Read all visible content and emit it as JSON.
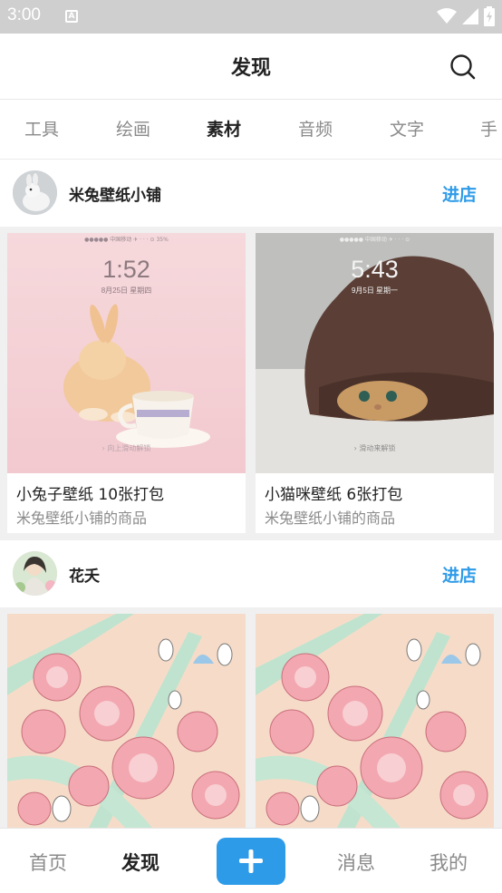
{
  "status_bar": {
    "time": "3:00"
  },
  "header": {
    "title": "发现"
  },
  "tabs": [
    {
      "label": "工具",
      "active": false
    },
    {
      "label": "绘画",
      "active": false
    },
    {
      "label": "素材",
      "active": true
    },
    {
      "label": "音频",
      "active": false
    },
    {
      "label": "文字",
      "active": false
    },
    {
      "label": "手",
      "active": false
    }
  ],
  "shops": [
    {
      "name": "米兔壁纸小铺",
      "enter_label": "进店",
      "products": [
        {
          "title": "小兔子壁纸 10张打包",
          "subtitle": "米兔壁纸小铺的商品",
          "lock_time": "1:52",
          "lock_date": "8月25日 星期四",
          "unlock_hint": "› 向上滑动解锁"
        },
        {
          "title": "小猫咪壁纸 6张打包",
          "subtitle": "米兔壁纸小铺的商品",
          "lock_time": "5:43",
          "lock_date": "9月5日 星期一",
          "unlock_hint": "› 滑动来解锁"
        }
      ]
    },
    {
      "name": "花夭",
      "enter_label": "进店",
      "products": []
    }
  ],
  "bottom_nav": {
    "home": "首页",
    "discover": "发现",
    "messages": "消息",
    "mine": "我的"
  },
  "colors": {
    "accent": "#2e9be8",
    "gap": "#f0f0f0"
  }
}
